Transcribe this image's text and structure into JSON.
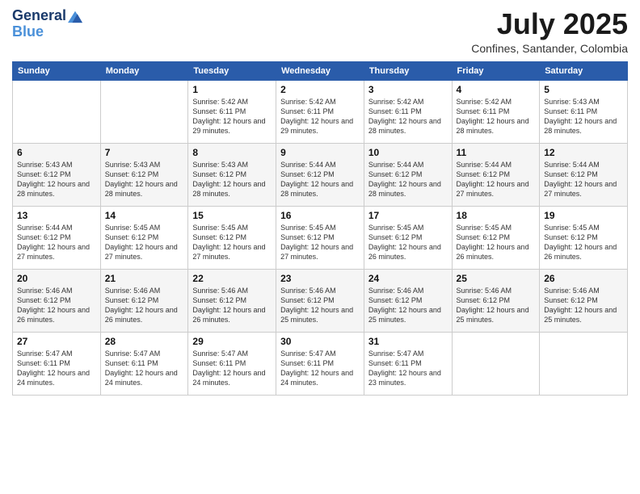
{
  "logo": {
    "line1": "General",
    "line2": "Blue"
  },
  "header": {
    "title": "July 2025",
    "subtitle": "Confines, Santander, Colombia"
  },
  "weekdays": [
    "Sunday",
    "Monday",
    "Tuesday",
    "Wednesday",
    "Thursday",
    "Friday",
    "Saturday"
  ],
  "weeks": [
    [
      {
        "day": "",
        "sunrise": "",
        "sunset": "",
        "daylight": ""
      },
      {
        "day": "",
        "sunrise": "",
        "sunset": "",
        "daylight": ""
      },
      {
        "day": "1",
        "sunrise": "Sunrise: 5:42 AM",
        "sunset": "Sunset: 6:11 PM",
        "daylight": "Daylight: 12 hours and 29 minutes."
      },
      {
        "day": "2",
        "sunrise": "Sunrise: 5:42 AM",
        "sunset": "Sunset: 6:11 PM",
        "daylight": "Daylight: 12 hours and 29 minutes."
      },
      {
        "day": "3",
        "sunrise": "Sunrise: 5:42 AM",
        "sunset": "Sunset: 6:11 PM",
        "daylight": "Daylight: 12 hours and 28 minutes."
      },
      {
        "day": "4",
        "sunrise": "Sunrise: 5:42 AM",
        "sunset": "Sunset: 6:11 PM",
        "daylight": "Daylight: 12 hours and 28 minutes."
      },
      {
        "day": "5",
        "sunrise": "Sunrise: 5:43 AM",
        "sunset": "Sunset: 6:11 PM",
        "daylight": "Daylight: 12 hours and 28 minutes."
      }
    ],
    [
      {
        "day": "6",
        "sunrise": "Sunrise: 5:43 AM",
        "sunset": "Sunset: 6:12 PM",
        "daylight": "Daylight: 12 hours and 28 minutes."
      },
      {
        "day": "7",
        "sunrise": "Sunrise: 5:43 AM",
        "sunset": "Sunset: 6:12 PM",
        "daylight": "Daylight: 12 hours and 28 minutes."
      },
      {
        "day": "8",
        "sunrise": "Sunrise: 5:43 AM",
        "sunset": "Sunset: 6:12 PM",
        "daylight": "Daylight: 12 hours and 28 minutes."
      },
      {
        "day": "9",
        "sunrise": "Sunrise: 5:44 AM",
        "sunset": "Sunset: 6:12 PM",
        "daylight": "Daylight: 12 hours and 28 minutes."
      },
      {
        "day": "10",
        "sunrise": "Sunrise: 5:44 AM",
        "sunset": "Sunset: 6:12 PM",
        "daylight": "Daylight: 12 hours and 28 minutes."
      },
      {
        "day": "11",
        "sunrise": "Sunrise: 5:44 AM",
        "sunset": "Sunset: 6:12 PM",
        "daylight": "Daylight: 12 hours and 27 minutes."
      },
      {
        "day": "12",
        "sunrise": "Sunrise: 5:44 AM",
        "sunset": "Sunset: 6:12 PM",
        "daylight": "Daylight: 12 hours and 27 minutes."
      }
    ],
    [
      {
        "day": "13",
        "sunrise": "Sunrise: 5:44 AM",
        "sunset": "Sunset: 6:12 PM",
        "daylight": "Daylight: 12 hours and 27 minutes."
      },
      {
        "day": "14",
        "sunrise": "Sunrise: 5:45 AM",
        "sunset": "Sunset: 6:12 PM",
        "daylight": "Daylight: 12 hours and 27 minutes."
      },
      {
        "day": "15",
        "sunrise": "Sunrise: 5:45 AM",
        "sunset": "Sunset: 6:12 PM",
        "daylight": "Daylight: 12 hours and 27 minutes."
      },
      {
        "day": "16",
        "sunrise": "Sunrise: 5:45 AM",
        "sunset": "Sunset: 6:12 PM",
        "daylight": "Daylight: 12 hours and 27 minutes."
      },
      {
        "day": "17",
        "sunrise": "Sunrise: 5:45 AM",
        "sunset": "Sunset: 6:12 PM",
        "daylight": "Daylight: 12 hours and 26 minutes."
      },
      {
        "day": "18",
        "sunrise": "Sunrise: 5:45 AM",
        "sunset": "Sunset: 6:12 PM",
        "daylight": "Daylight: 12 hours and 26 minutes."
      },
      {
        "day": "19",
        "sunrise": "Sunrise: 5:45 AM",
        "sunset": "Sunset: 6:12 PM",
        "daylight": "Daylight: 12 hours and 26 minutes."
      }
    ],
    [
      {
        "day": "20",
        "sunrise": "Sunrise: 5:46 AM",
        "sunset": "Sunset: 6:12 PM",
        "daylight": "Daylight: 12 hours and 26 minutes."
      },
      {
        "day": "21",
        "sunrise": "Sunrise: 5:46 AM",
        "sunset": "Sunset: 6:12 PM",
        "daylight": "Daylight: 12 hours and 26 minutes."
      },
      {
        "day": "22",
        "sunrise": "Sunrise: 5:46 AM",
        "sunset": "Sunset: 6:12 PM",
        "daylight": "Daylight: 12 hours and 26 minutes."
      },
      {
        "day": "23",
        "sunrise": "Sunrise: 5:46 AM",
        "sunset": "Sunset: 6:12 PM",
        "daylight": "Daylight: 12 hours and 25 minutes."
      },
      {
        "day": "24",
        "sunrise": "Sunrise: 5:46 AM",
        "sunset": "Sunset: 6:12 PM",
        "daylight": "Daylight: 12 hours and 25 minutes."
      },
      {
        "day": "25",
        "sunrise": "Sunrise: 5:46 AM",
        "sunset": "Sunset: 6:12 PM",
        "daylight": "Daylight: 12 hours and 25 minutes."
      },
      {
        "day": "26",
        "sunrise": "Sunrise: 5:46 AM",
        "sunset": "Sunset: 6:12 PM",
        "daylight": "Daylight: 12 hours and 25 minutes."
      }
    ],
    [
      {
        "day": "27",
        "sunrise": "Sunrise: 5:47 AM",
        "sunset": "Sunset: 6:11 PM",
        "daylight": "Daylight: 12 hours and 24 minutes."
      },
      {
        "day": "28",
        "sunrise": "Sunrise: 5:47 AM",
        "sunset": "Sunset: 6:11 PM",
        "daylight": "Daylight: 12 hours and 24 minutes."
      },
      {
        "day": "29",
        "sunrise": "Sunrise: 5:47 AM",
        "sunset": "Sunset: 6:11 PM",
        "daylight": "Daylight: 12 hours and 24 minutes."
      },
      {
        "day": "30",
        "sunrise": "Sunrise: 5:47 AM",
        "sunset": "Sunset: 6:11 PM",
        "daylight": "Daylight: 12 hours and 24 minutes."
      },
      {
        "day": "31",
        "sunrise": "Sunrise: 5:47 AM",
        "sunset": "Sunset: 6:11 PM",
        "daylight": "Daylight: 12 hours and 23 minutes."
      },
      {
        "day": "",
        "sunrise": "",
        "sunset": "",
        "daylight": ""
      },
      {
        "day": "",
        "sunrise": "",
        "sunset": "",
        "daylight": ""
      }
    ]
  ]
}
